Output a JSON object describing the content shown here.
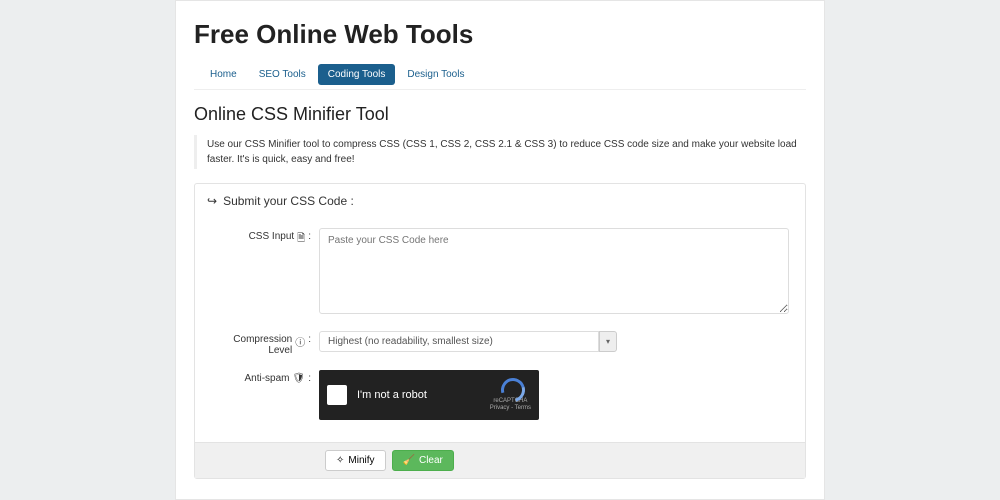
{
  "site": {
    "title": "Free Online Web Tools"
  },
  "nav": {
    "items": [
      {
        "label": "Home"
      },
      {
        "label": "SEO Tools"
      },
      {
        "label": "Coding Tools"
      },
      {
        "label": "Design Tools"
      }
    ]
  },
  "page": {
    "title": "Online CSS Minifier Tool",
    "intro": "Use our CSS Minifier tool to compress CSS (CSS 1, CSS 2, CSS 2.1 & CSS 3) to reduce CSS code size and make your website load faster. It's is quick, easy and free!"
  },
  "form": {
    "heading": "Submit your CSS Code :",
    "css_input": {
      "label": "CSS Input",
      "placeholder": "Paste your CSS Code here"
    },
    "compression": {
      "label": "Compression Level",
      "selected": "Highest (no readability, smallest size)"
    },
    "antispam": {
      "label": "Anti-spam",
      "captcha_text": "I'm not a robot",
      "captcha_brand": "reCAPTCHA",
      "captcha_terms": "Privacy - Terms"
    },
    "buttons": {
      "minify": "Minify",
      "clear": "Clear"
    }
  }
}
